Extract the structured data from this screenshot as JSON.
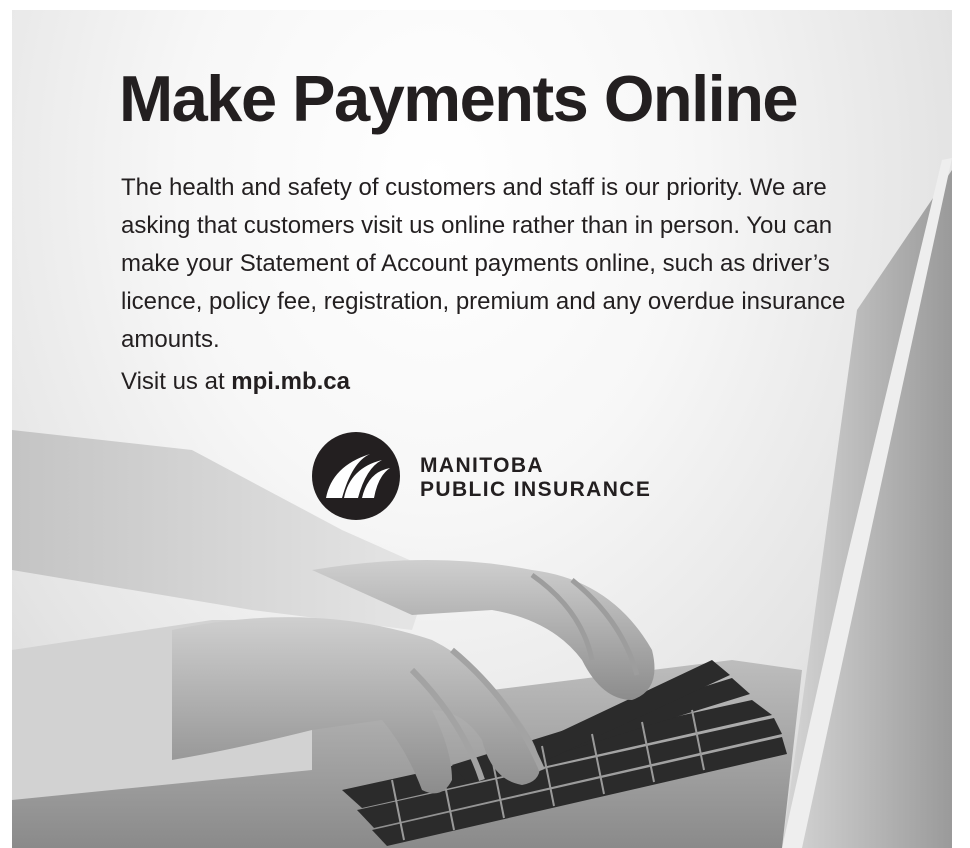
{
  "headline": "Make Payments Online",
  "body": "The health and safety of customers and staff is our priority. We are asking that customers visit us online rather than in person. You can make your Statement of Account payments online, such as driver’s licence, policy fee, registration, premium and any overdue insurance amounts.",
  "visit": {
    "prefix": "Visit us at ",
    "url": "mpi.mb.ca"
  },
  "logo": {
    "line1": "MANITOBA",
    "line2": "PUBLIC INSURANCE",
    "icon": "mpi-logo-icon"
  },
  "photo": {
    "icon": "hands-on-laptop-keyboard-photo"
  },
  "colors": {
    "text": "#231f20",
    "logo": "#231f20",
    "background": "#f2f2f2"
  }
}
